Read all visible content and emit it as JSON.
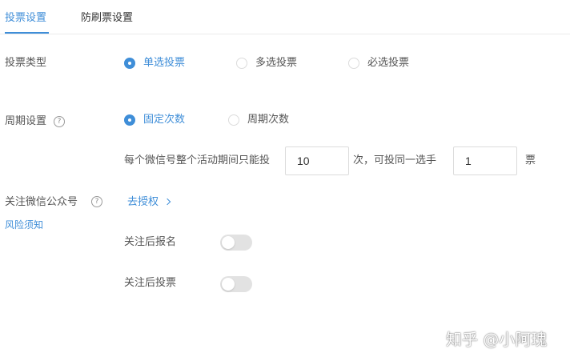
{
  "tabs": [
    {
      "label": "投票设置",
      "active": true
    },
    {
      "label": "防刷票设置",
      "active": false
    }
  ],
  "vote_type": {
    "label": "投票类型",
    "options": [
      {
        "label": "单选投票",
        "checked": true
      },
      {
        "label": "多选投票",
        "checked": false
      },
      {
        "label": "必选投票",
        "checked": false
      }
    ]
  },
  "cycle": {
    "label": "周期设置",
    "help_icon": "?",
    "options": [
      {
        "label": "固定次数",
        "checked": true
      },
      {
        "label": "周期次数",
        "checked": false
      }
    ],
    "limit_text_prefix": "每个微信号整个活动期间只能投",
    "times_value": "10",
    "limit_text_middle": "次，可投同一选手",
    "votes_value": "1",
    "limit_text_suffix": "票"
  },
  "follow": {
    "label": "关注微信公众号",
    "help_icon": "?",
    "risk_link": "风险须知",
    "authorize_link": "去授权",
    "toggles": [
      {
        "label": "关注后报名",
        "on": false
      },
      {
        "label": "关注后投票",
        "on": false
      }
    ]
  },
  "watermark": "知乎 @小阿瑰",
  "colors": {
    "accent": "#3f8ed8",
    "toggle_off": "#e2e2e2",
    "border": "#dcdcdc"
  }
}
